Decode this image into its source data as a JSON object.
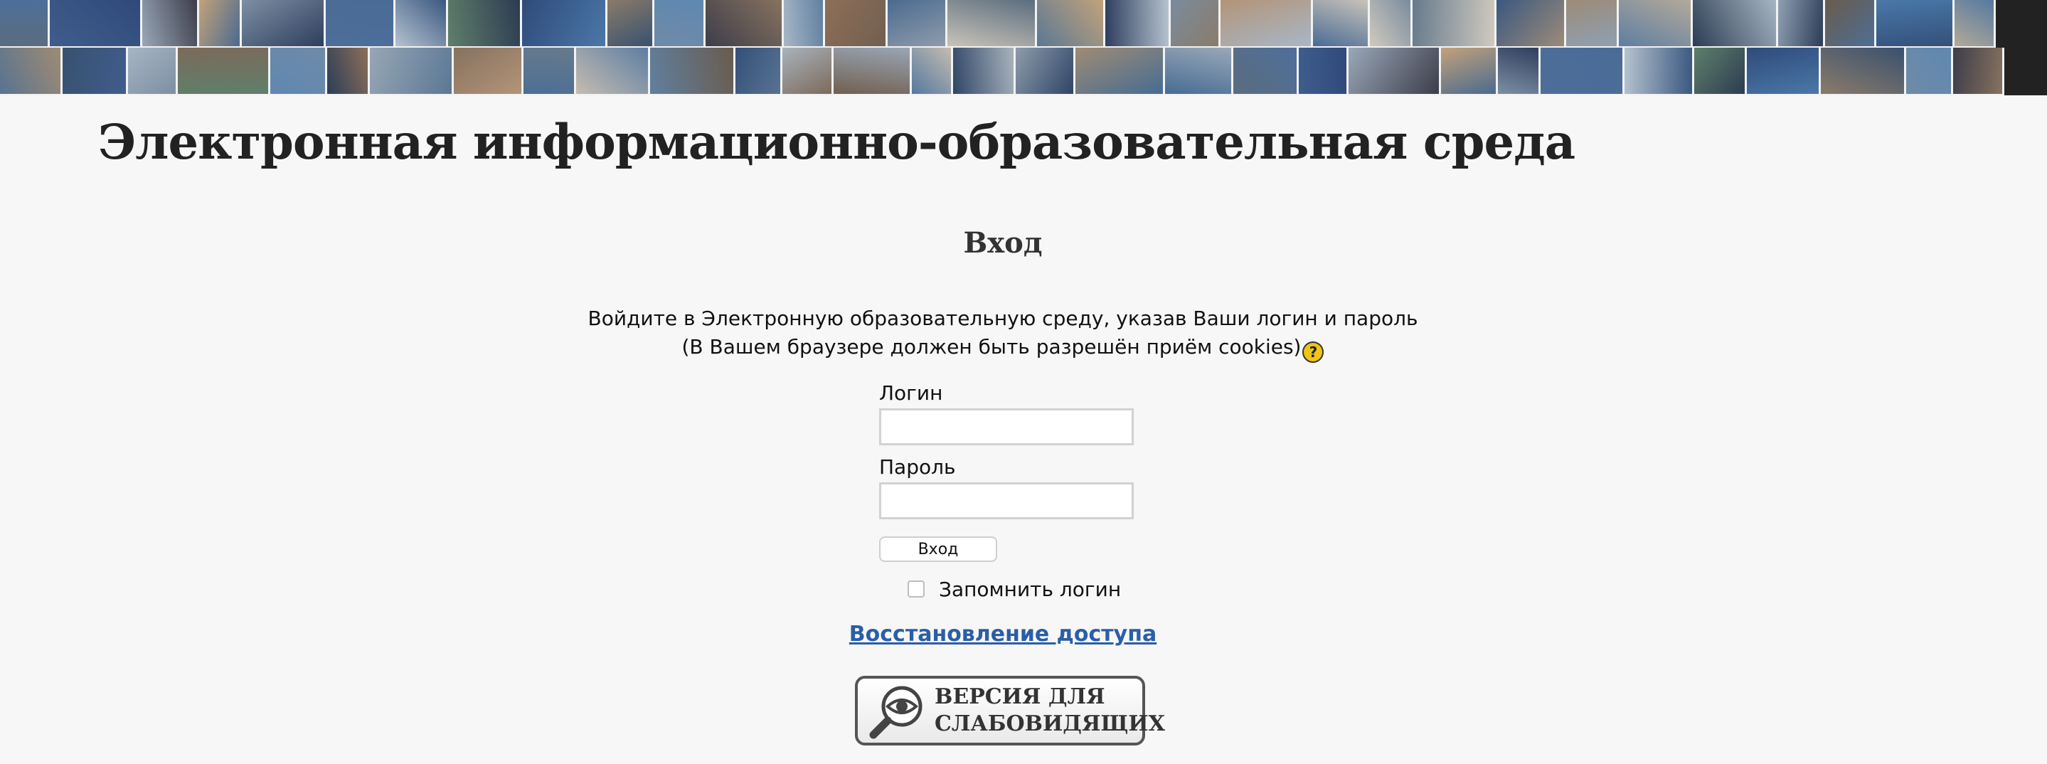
{
  "banner": {
    "alt": "photo-collage",
    "tile_colors": [
      "#5b6d7e",
      "#3f5d8c",
      "#9aa8b8",
      "#c2a27a",
      "#7d8fa3",
      "#4e6e9a",
      "#b6c2cf",
      "#5f7f6a",
      "#2f4a7a",
      "#8a7b6a",
      "#6f8aa8",
      "#3d3d4a",
      "#a8b7c7",
      "#8d6f58",
      "#4b6a8f",
      "#c9c3b8",
      "#5a7894",
      "#2e3e5e",
      "#7a8c9e",
      "#b39478",
      "#496b96",
      "#d0cabf",
      "#667a8c",
      "#3a5880",
      "#9c8b78",
      "#5d7ea3",
      "#2c3c52",
      "#8fa0b2",
      "#6a5b4d",
      "#4a78a8",
      "#b4a999",
      "#587390",
      "#39516f",
      "#a7b5c3",
      "#7c6a5a",
      "#5f88b0",
      "#2b3d57",
      "#98a6b5",
      "#86725f",
      "#4d6f95",
      "#c5bcb0",
      "#60809f",
      "#34507a",
      "#a9b3bd",
      "#725f50",
      "#5479a0",
      "#2f4566",
      "#8e9cab",
      "#a08b74",
      "#466c93"
    ]
  },
  "site_title": "Электронная информационно-образовательная среда",
  "login": {
    "heading": "Вход",
    "intro_line1": "Войдите в Электронную образовательную среду, указав Ваши логин и пароль",
    "intro_line2": "(В Вашем браузере должен быть разрешён приём cookies)",
    "help_glyph": "?",
    "username_label": "Логин",
    "username_value": "",
    "password_label": "Пароль",
    "password_value": "",
    "submit_label": "Вход",
    "remember_label": "Запомнить логин",
    "remember_checked": false,
    "restore_link": "Восстановление доступа"
  },
  "low_vision_button": {
    "line1": "ВЕРСИЯ ДЛЯ",
    "line2": "СЛАБОВИДЯЩИХ",
    "icon": "magnifier-eye-icon"
  }
}
